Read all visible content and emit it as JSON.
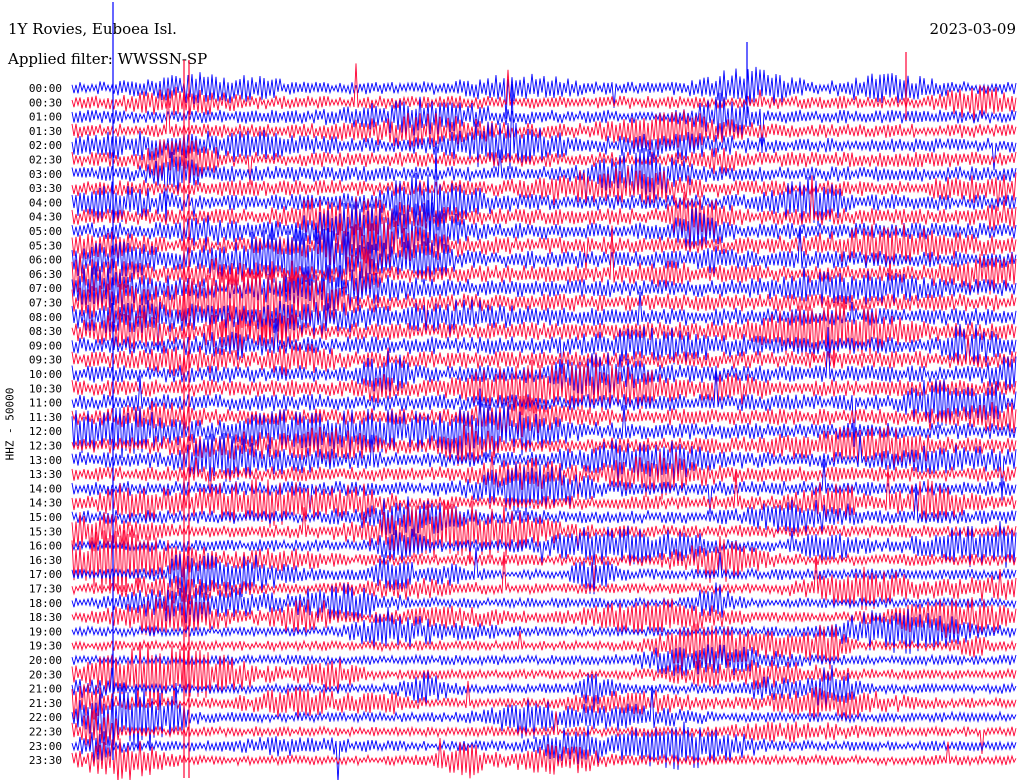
{
  "header": {
    "station": "1Y Rovies, Euboea Isl.",
    "date": "2023-03-09",
    "filter": "Applied filter: WWSSN-SP"
  },
  "chart_data": {
    "type": "line",
    "title": "1Y Rovies, Euboea Isl.",
    "subtitle": "Applied filter: WWSSN-SP",
    "date": "2023-03-09",
    "ylabel": "HHZ - 50000",
    "row_interval_minutes": 30,
    "y_tick_labels": [
      "00:00",
      "00:30",
      "01:00",
      "01:30",
      "02:00",
      "02:30",
      "03:00",
      "03:30",
      "04:00",
      "04:30",
      "05:00",
      "05:30",
      "06:00",
      "06:30",
      "07:00",
      "07:30",
      "08:00",
      "08:30",
      "09:00",
      "09:30",
      "10:00",
      "10:30",
      "11:00",
      "11:30",
      "12:00",
      "12:30",
      "13:00",
      "13:30",
      "14:00",
      "14:30",
      "15:00",
      "15:30",
      "16:00",
      "16:30",
      "17:00",
      "17:30",
      "18:00",
      "18:30",
      "19:00",
      "19:30",
      "20:00",
      "20:30",
      "21:00",
      "21:30",
      "22:00",
      "22:30",
      "23:00",
      "23:30"
    ],
    "trace_colors": [
      "#0000ff",
      "#ff0033"
    ],
    "grid": false,
    "legend": "none"
  }
}
